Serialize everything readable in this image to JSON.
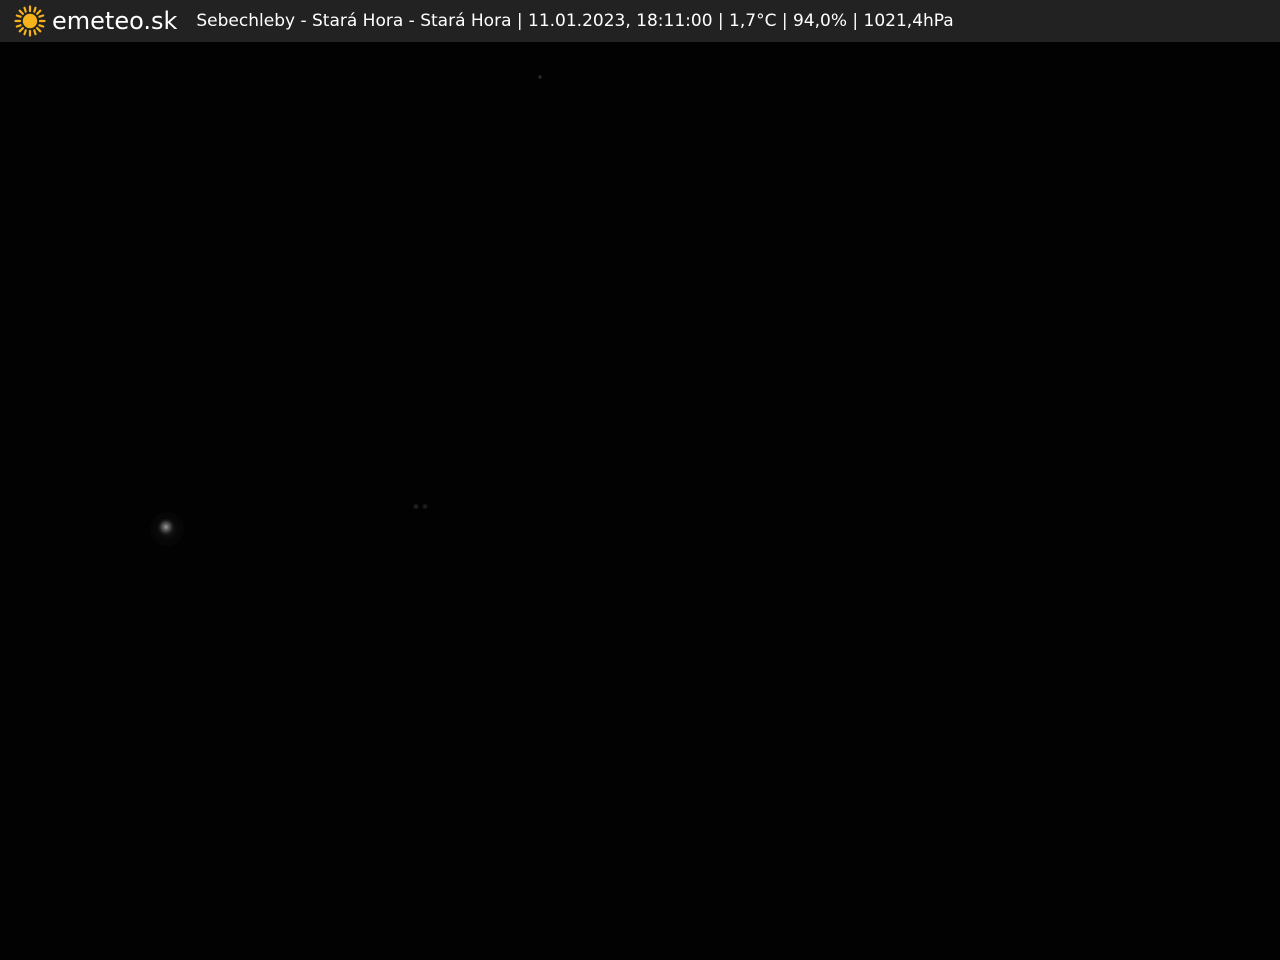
{
  "header": {
    "logo_icon": "sun-icon",
    "brand": "emeteo.sk",
    "caption": "Sebechleby - Stará Hora - Stará Hora | 11.01.2023, 18:11:00 | 1,7°C | 94,0% | 1021,4hPa"
  },
  "colors": {
    "bar_background": "#222222",
    "sun": "#f5b21b",
    "text": "#ffffff",
    "camera_background": "#010101"
  }
}
